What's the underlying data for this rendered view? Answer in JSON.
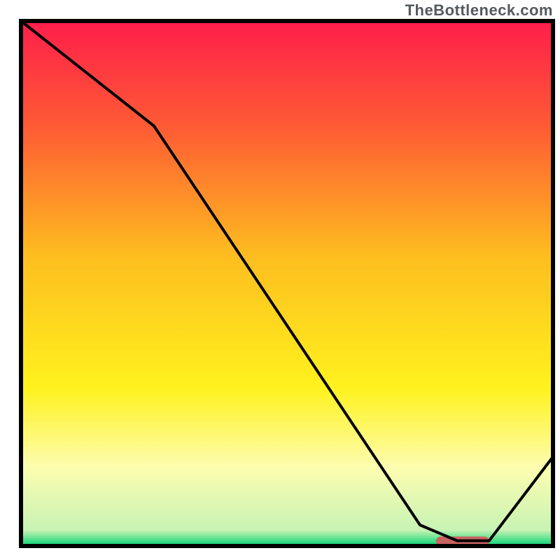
{
  "watermark": "TheBottleneck.com",
  "chart_data": {
    "type": "line",
    "title": "",
    "xlabel": "",
    "ylabel": "",
    "xlim": [
      0,
      100
    ],
    "ylim": [
      0,
      100
    ],
    "x": [
      0,
      25,
      75,
      82,
      88,
      100
    ],
    "values": [
      100,
      80,
      4,
      1,
      1,
      17
    ],
    "optimal_band_x": [
      78,
      88
    ],
    "gradient_stops": [
      {
        "pct": 0,
        "color": "#FF1E4B"
      },
      {
        "pct": 20,
        "color": "#FE5A34"
      },
      {
        "pct": 45,
        "color": "#FEBE1F"
      },
      {
        "pct": 70,
        "color": "#FFF21E"
      },
      {
        "pct": 85,
        "color": "#FDFDB0"
      },
      {
        "pct": 97,
        "color": "#C8F3B4"
      },
      {
        "pct": 100,
        "color": "#00D371"
      }
    ],
    "colors": {
      "frame": "#000000",
      "curve": "#000000",
      "optimal_band": "#C96262"
    }
  }
}
